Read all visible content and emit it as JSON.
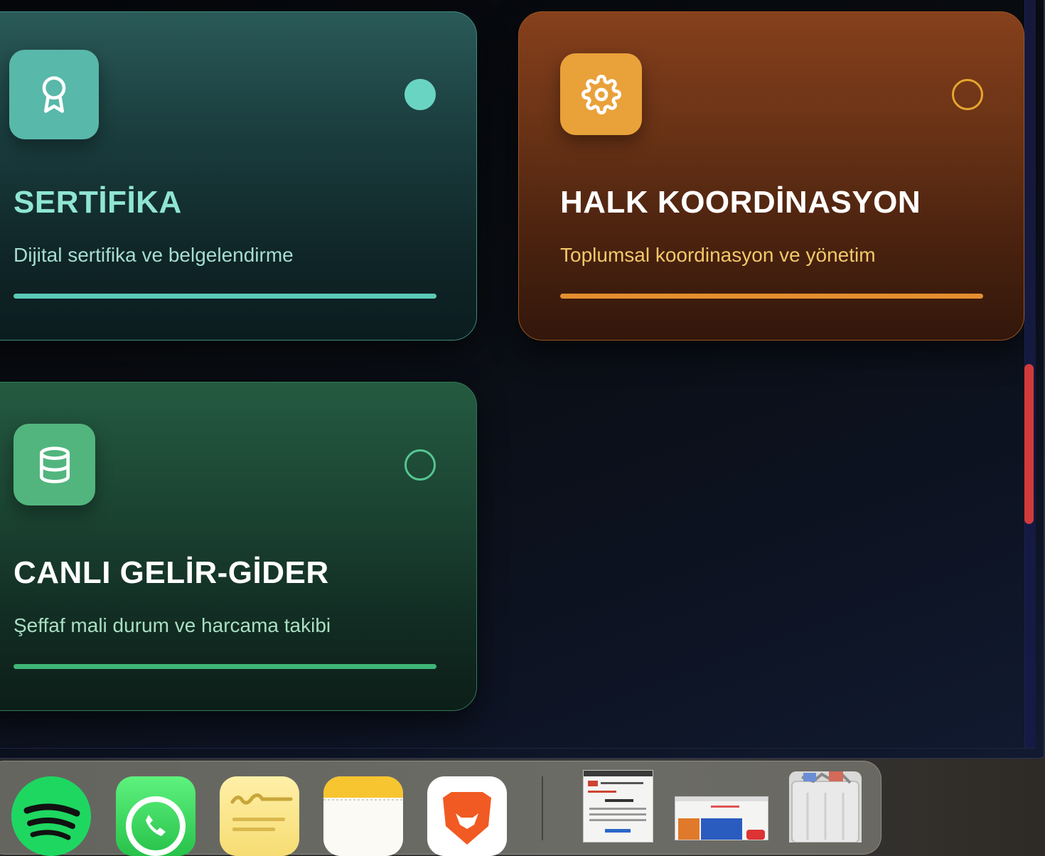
{
  "cards": [
    {
      "id": "sertifika",
      "title": "SERTİFİKA",
      "description": "Dijital sertifika ve belgelendirme",
      "icon": "award-ribbon-icon",
      "status": "active",
      "accent": "#5ccab6"
    },
    {
      "id": "halk-koordinasyon",
      "title": "HALK KOORDİNASYON",
      "description": "Toplumsal koordinasyon ve yönetim",
      "icon": "gear-icon",
      "status": "inactive",
      "accent": "#e48f30"
    },
    {
      "id": "canli-gelir-gider",
      "title": "CANLI GELİR-GİDER",
      "description": "Şeffaf mali durum ve harcama takibi",
      "icon": "database-icon",
      "status": "inactive",
      "accent": "#3fb677"
    }
  ],
  "scrollbar": {
    "thumb_color": "#d33a3a"
  },
  "dock": {
    "apps": [
      "Spotify",
      "WhatsApp",
      "Stickies",
      "Notes",
      "Brave Browser"
    ],
    "minimized_windows": 2,
    "trash": "Trash"
  }
}
